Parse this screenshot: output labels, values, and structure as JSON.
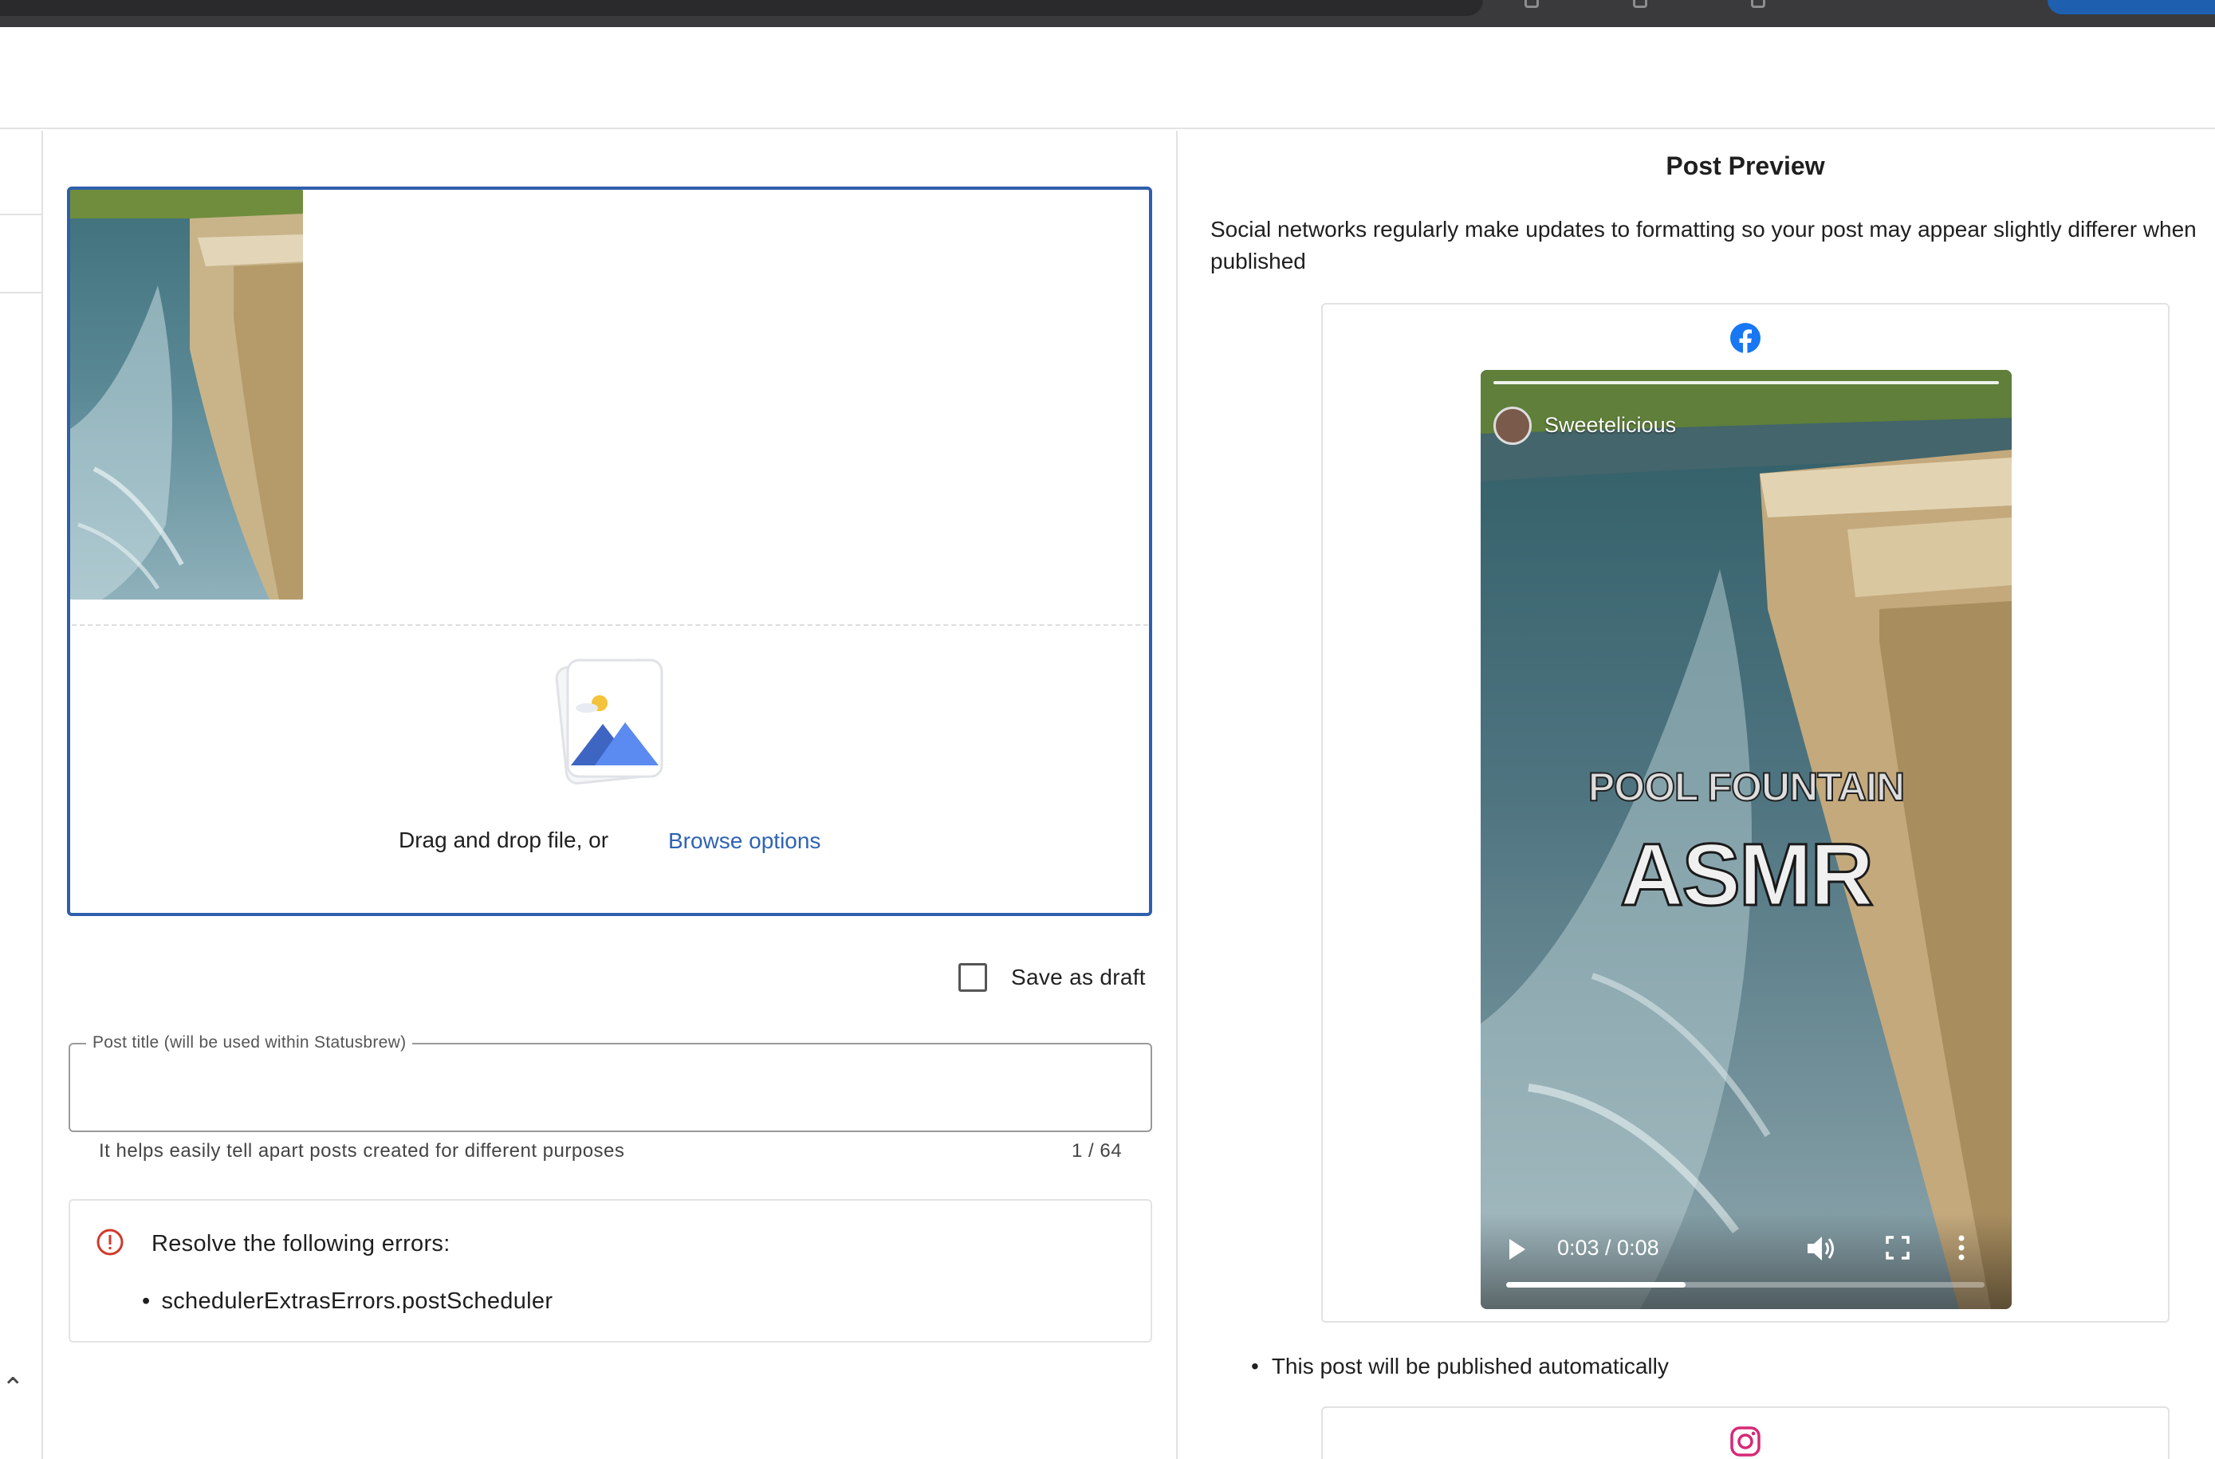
{
  "compose": {
    "drop_text": "Drag and drop file, or",
    "browse_label": "Browse options",
    "save_draft_label": "Save as draft",
    "save_draft_checked": false,
    "post_title_legend": "Post title (will be used within Statusbrew)",
    "post_title_value": "",
    "post_title_helper": "It helps easily tell apart posts created for different purposes",
    "post_title_counter": "1 / 64",
    "errors": {
      "title": "Resolve the following errors:",
      "items": [
        "schedulerExtrasErrors.postScheduler"
      ]
    }
  },
  "preview": {
    "title": "Post Preview",
    "description": "Social networks regularly make updates to formatting so your post may appear slightly differer when published",
    "facebook": {
      "icon": "facebook-icon",
      "story_name": "Sweetelicious",
      "overlay_small": "POOL FOUNTAIN",
      "overlay_big": "ASMR",
      "time": "0:03 / 0:08",
      "progress_fraction": 0.375
    },
    "publish_note": "This post will be published automatically",
    "instagram": {
      "icon": "instagram-icon"
    }
  },
  "colors": {
    "accent": "#2e5fac",
    "link": "#2f63b3",
    "error": "#d0392b",
    "facebook": "#1877f2",
    "instagram": "#d62976"
  }
}
